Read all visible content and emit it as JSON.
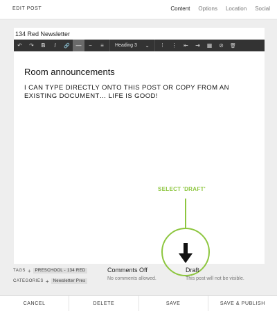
{
  "header": {
    "title": "EDIT POST",
    "tabs": [
      {
        "label": "Content",
        "active": true
      },
      {
        "label": "Options",
        "active": false
      },
      {
        "label": "Location",
        "active": false
      },
      {
        "label": "Social",
        "active": false
      }
    ]
  },
  "editor": {
    "post_title": "134 Red Newsletter",
    "toolbar": {
      "undo_icon": "↶",
      "redo_icon": "↷",
      "bold_icon": "B",
      "italic_icon": "I",
      "link_icon": "🔗",
      "hr_icon": "—",
      "strike_icon": "−",
      "align_icon": "≡",
      "heading_value": "Heading 3",
      "chevron": "⌄",
      "ol_icon": "⁞",
      "ul_icon": "⋮",
      "indent_icon": "⇤",
      "outdent_icon": "⇥",
      "table_icon": "▦",
      "clear_icon": "⊘",
      "trash_icon": "🗑"
    },
    "heading": "Room announcements",
    "body": "I can type directly onto this post or copy from an existing document… life is good!"
  },
  "annotation": {
    "label": "SELECT 'DRAFT'",
    "color": "#8dc63f",
    "arrow_icon": "arrow-down-icon"
  },
  "meta": {
    "tags_label": "TAGS",
    "tag_chip": "PRESCHOOL - 134 RED",
    "categories_label": "CATEGORIES",
    "category_chip": "Newsletter Pres",
    "plus": "+"
  },
  "comments": {
    "status": "Comments Off",
    "description": "No comments allowed."
  },
  "post_status": {
    "status": "Draft",
    "description": "This post will not be visible."
  },
  "footer": {
    "cancel": "CANCEL",
    "delete": "DELETE",
    "save": "SAVE",
    "save_publish": "SAVE & PUBLISH"
  }
}
